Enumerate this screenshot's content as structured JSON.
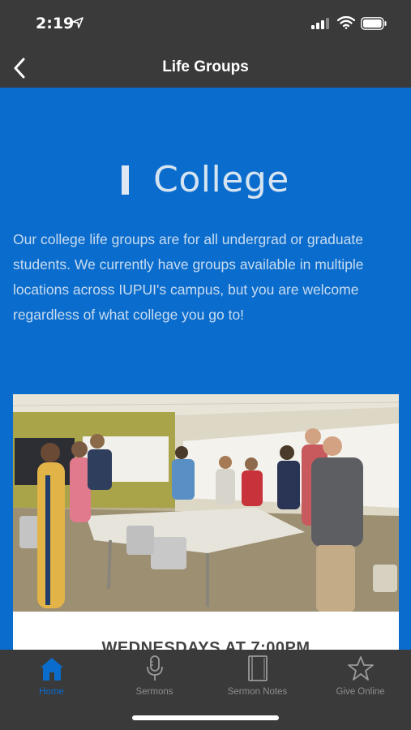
{
  "status_bar": {
    "time": "2:19"
  },
  "nav": {
    "title": "Life Groups"
  },
  "section": {
    "heading": "College",
    "description": "Our college life groups are for all undergrad or graduate students.  We currently have groups available in multiple locations across IUPUI's campus, but you are welcome regardless of what college you go to!"
  },
  "card": {
    "title": "WEDNESDAYS AT 7:00PM"
  },
  "tabs": [
    {
      "label": "Home",
      "icon": "home-icon",
      "active": true
    },
    {
      "label": "Sermons",
      "icon": "microphone-icon",
      "active": false
    },
    {
      "label": "Sermon Notes",
      "icon": "notebook-icon",
      "active": false
    },
    {
      "label": "Give Online",
      "icon": "star-icon",
      "active": false
    }
  ],
  "colors": {
    "accent": "#0a6ccc",
    "bar": "#3a3a3a"
  }
}
